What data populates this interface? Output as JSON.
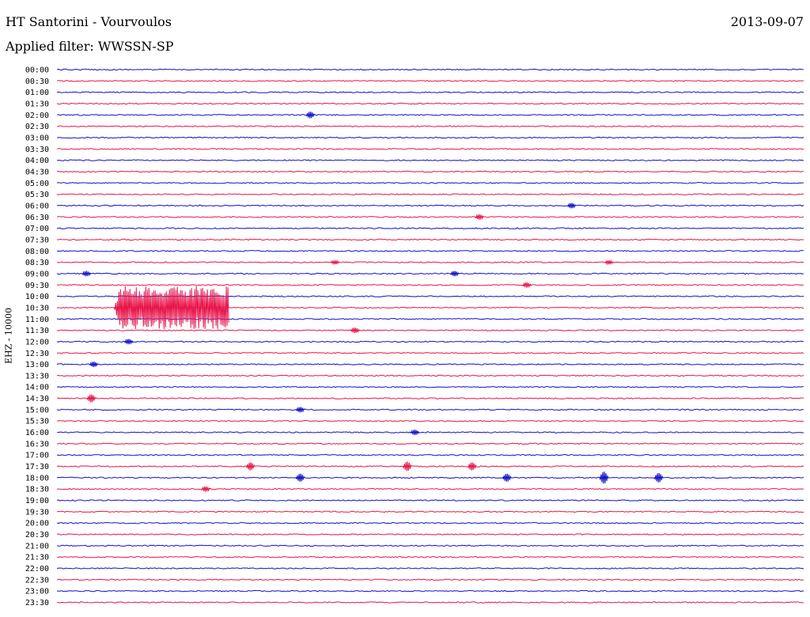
{
  "header": {
    "station": "HT Santorini - Vourvoulos",
    "date": "2013-09-07",
    "filter": "Applied filter: WWSSN-SP"
  },
  "channel_label": "EHZ - 10000",
  "colors": {
    "trace_a": "#1010cc",
    "trace_b": "#e8144a",
    "background": "#ffffff"
  },
  "chart_data": {
    "type": "line",
    "title": "HT Santorini - Vourvoulos",
    "subtitle": "Applied filter: WWSSN-SP",
    "ylabel": "EHZ - 10000",
    "xlabel": "",
    "x_range_minutes": [
      0,
      30
    ],
    "rows": [
      "00:00",
      "00:30",
      "01:00",
      "01:30",
      "02:00",
      "02:30",
      "03:00",
      "03:30",
      "04:00",
      "04:30",
      "05:00",
      "05:30",
      "06:00",
      "06:30",
      "07:00",
      "07:30",
      "08:00",
      "08:30",
      "09:00",
      "09:30",
      "10:00",
      "10:30",
      "11:00",
      "11:30",
      "12:00",
      "12:30",
      "13:00",
      "13:30",
      "14:00",
      "14:30",
      "15:00",
      "15:30",
      "16:00",
      "16:30",
      "17:00",
      "17:30",
      "18:00",
      "18:30",
      "19:00",
      "19:30",
      "20:00",
      "20:30",
      "21:00",
      "21:30",
      "22:00",
      "22:30",
      "23:00",
      "23:30"
    ],
    "series": [
      {
        "color": "#1010cc"
      },
      {
        "color": "#e8144a"
      }
    ],
    "events": [
      {
        "row": "02:00",
        "minute": 10.0,
        "amplitude": 0.25
      },
      {
        "row": "06:00",
        "minute": 20.5,
        "amplitude": 0.2
      },
      {
        "row": "06:30",
        "minute": 16.8,
        "amplitude": 0.2
      },
      {
        "row": "08:30",
        "minute": 22.0,
        "amplitude": 0.15
      },
      {
        "row": "08:30",
        "minute": 11.0,
        "amplitude": 0.15
      },
      {
        "row": "09:00",
        "minute": 1.0,
        "amplitude": 0.2
      },
      {
        "row": "09:00",
        "minute": 15.8,
        "amplitude": 0.2
      },
      {
        "row": "09:30",
        "minute": 18.7,
        "amplitude": 0.2
      },
      {
        "row": "10:30",
        "minute": 2.3,
        "amplitude": 1.6,
        "duration": 4.6
      },
      {
        "row": "11:30",
        "minute": 11.8,
        "amplitude": 0.2
      },
      {
        "row": "12:00",
        "minute": 2.7,
        "amplitude": 0.2
      },
      {
        "row": "13:00",
        "minute": 1.3,
        "amplitude": 0.2
      },
      {
        "row": "14:30",
        "minute": 1.2,
        "amplitude": 0.3
      },
      {
        "row": "15:00",
        "minute": 9.6,
        "amplitude": 0.2
      },
      {
        "row": "16:00",
        "minute": 14.2,
        "amplitude": 0.2
      },
      {
        "row": "17:30",
        "minute": 7.6,
        "amplitude": 0.3
      },
      {
        "row": "17:30",
        "minute": 13.9,
        "amplitude": 0.35
      },
      {
        "row": "17:30",
        "minute": 16.5,
        "amplitude": 0.3
      },
      {
        "row": "18:00",
        "minute": 9.6,
        "amplitude": 0.3
      },
      {
        "row": "18:00",
        "minute": 17.9,
        "amplitude": 0.3
      },
      {
        "row": "18:00",
        "minute": 21.8,
        "amplitude": 0.45
      },
      {
        "row": "18:00",
        "minute": 24.0,
        "amplitude": 0.35
      },
      {
        "row": "18:30",
        "minute": 5.8,
        "amplitude": 0.2
      }
    ],
    "grid": false
  }
}
